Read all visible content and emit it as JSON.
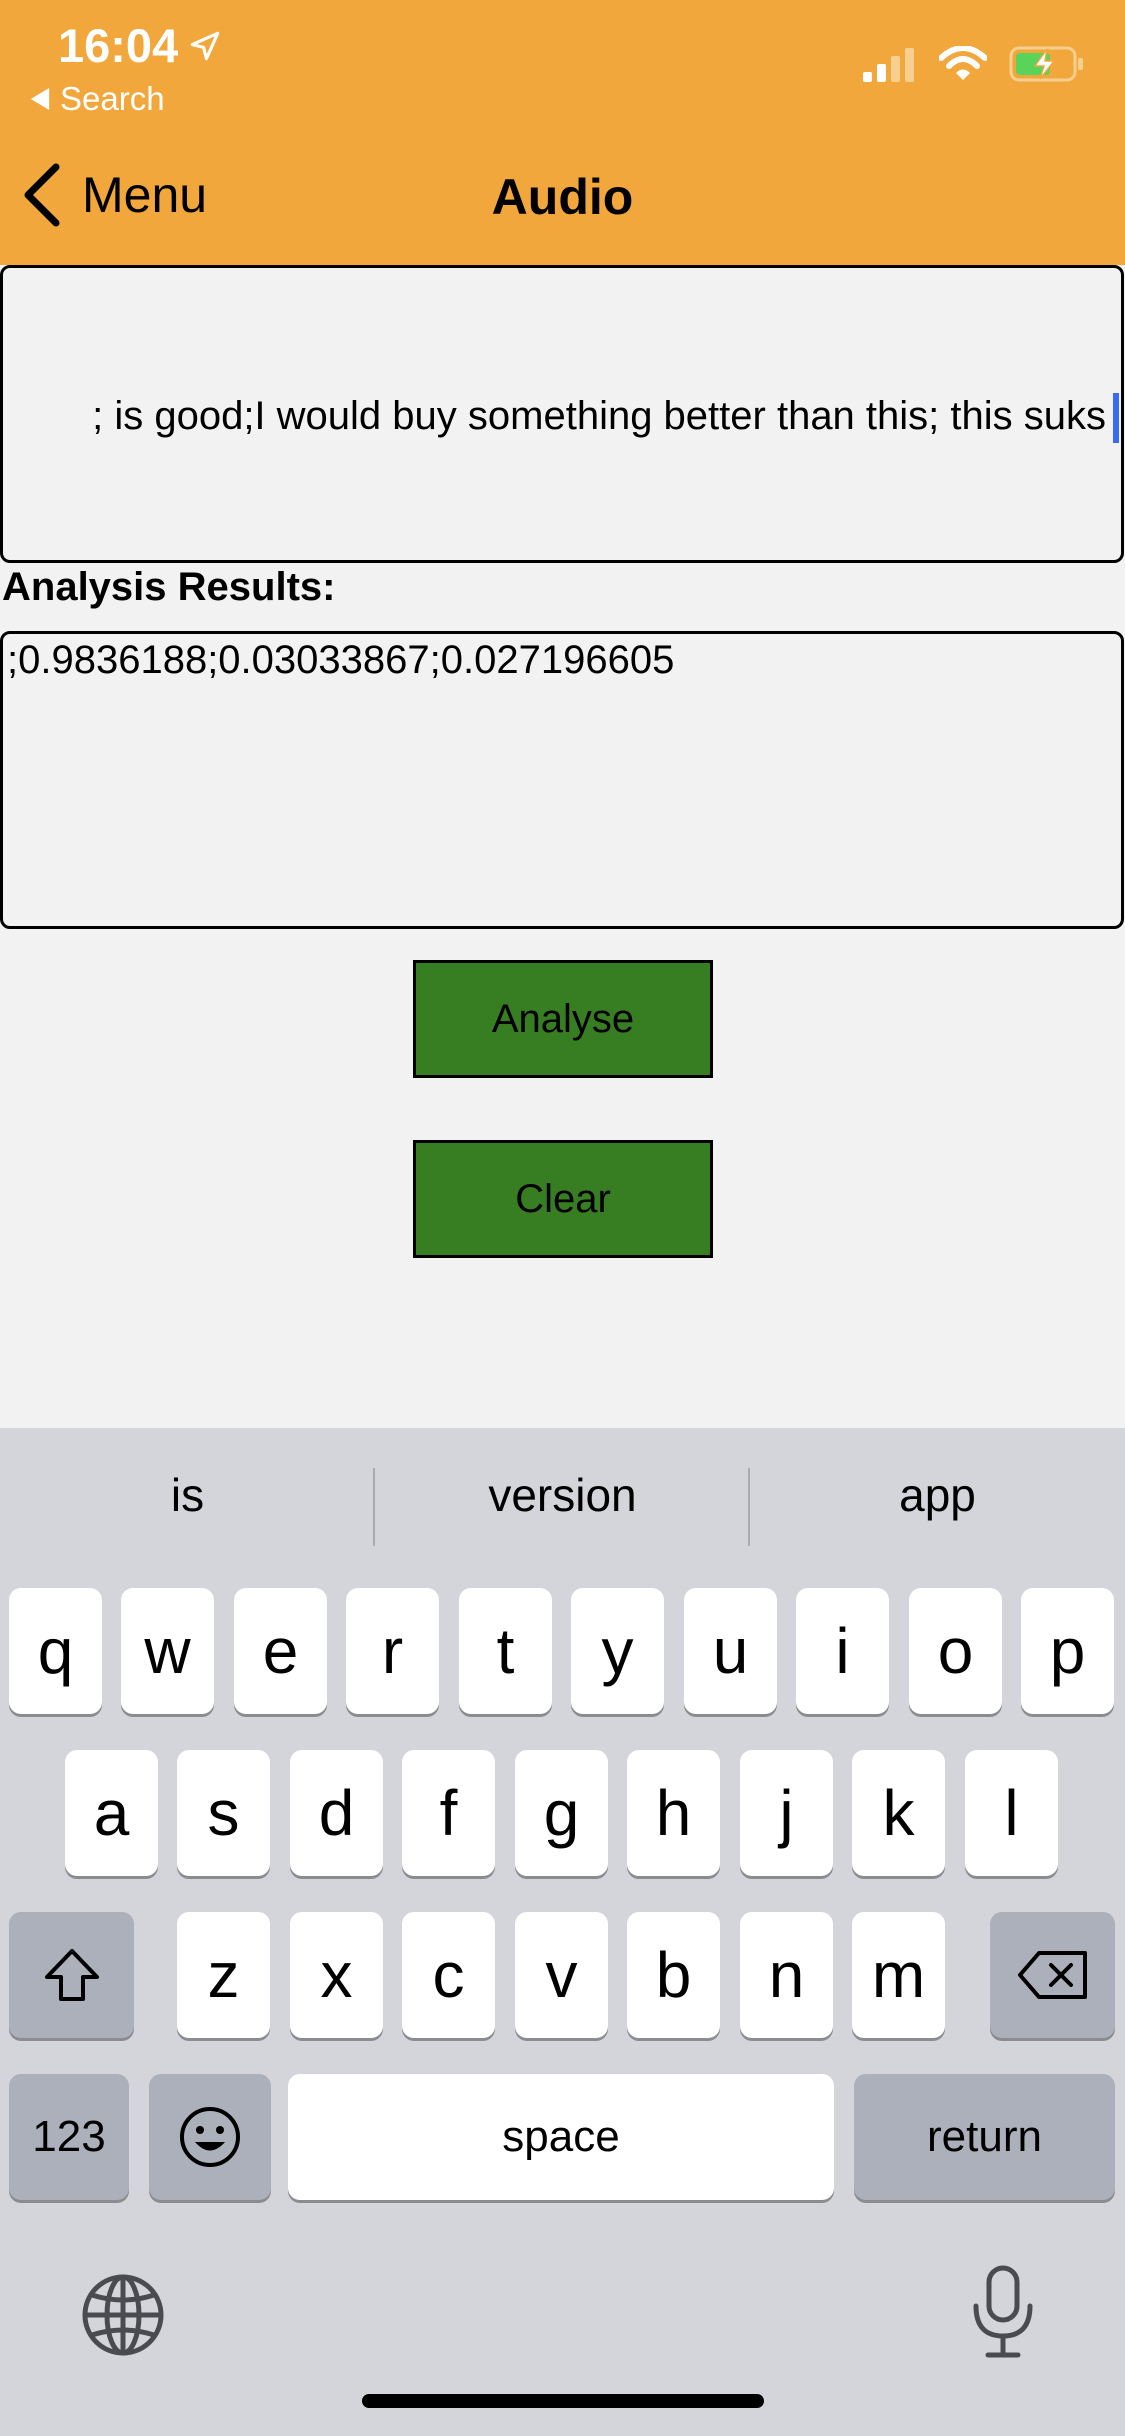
{
  "status": {
    "time": "16:04",
    "back_label": "Search",
    "icons": [
      "location-arrow-icon",
      "cellular-signal-icon",
      "wifi-icon",
      "battery-charging-icon"
    ]
  },
  "nav": {
    "back_label": "Menu",
    "title": "Audio"
  },
  "input": {
    "value": "; is good;I would buy something better than this; this suks"
  },
  "results": {
    "label": "Analysis Results:",
    "value": ";0.9836188;0.03033867;0.027196605"
  },
  "buttons": {
    "analyse": "Analyse",
    "clear": "Clear"
  },
  "colors": {
    "header": "#f1a73b",
    "button": "#377d22",
    "caret": "#3a6cf2",
    "keyboard_bg": "#d3d5db"
  },
  "keyboard": {
    "suggestions": [
      "is",
      "version",
      "app"
    ],
    "row1": [
      "q",
      "w",
      "e",
      "r",
      "t",
      "y",
      "u",
      "i",
      "o",
      "p"
    ],
    "row2": [
      "a",
      "s",
      "d",
      "f",
      "g",
      "h",
      "j",
      "k",
      "l"
    ],
    "row3": [
      "z",
      "x",
      "c",
      "v",
      "b",
      "n",
      "m"
    ],
    "numbers_label": "123",
    "space_label": "space",
    "return_label": "return"
  }
}
